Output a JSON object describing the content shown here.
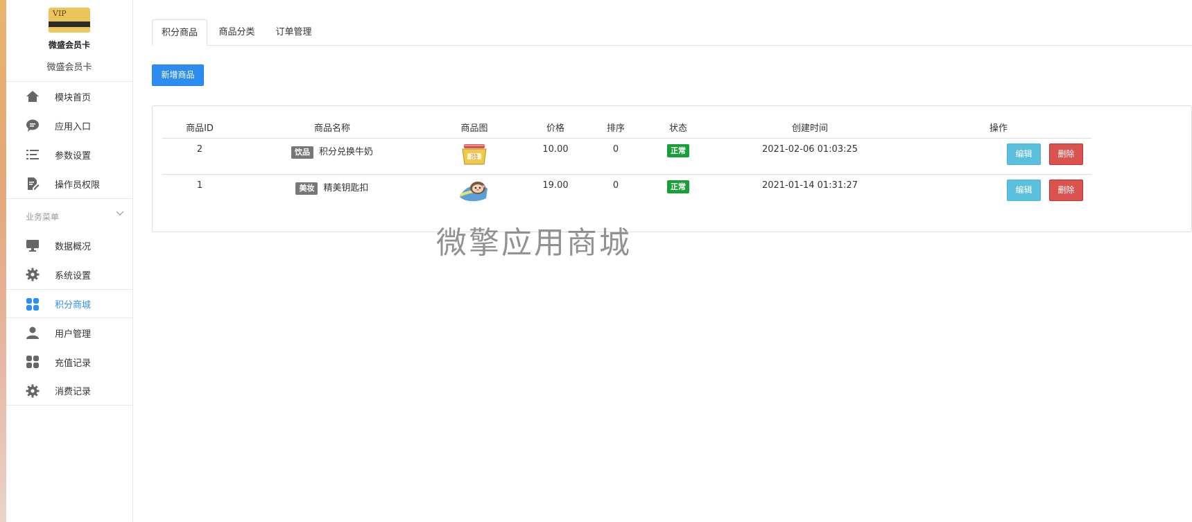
{
  "sidebar": {
    "brand_card_text": "VIP",
    "brand_name": "微盛会员卡",
    "brand_sub": "微盛会员卡",
    "top_items": [
      {
        "label": "模块首页",
        "icon": "home-icon"
      },
      {
        "label": "应用入口",
        "icon": "chat-bubble-icon"
      },
      {
        "label": "参数设置",
        "icon": "list-settings-icon"
      },
      {
        "label": "操作员权限",
        "icon": "edit-document-icon"
      }
    ],
    "group_title": "业务菜单",
    "group_items": [
      {
        "label": "数据概况",
        "icon": "monitor-icon"
      },
      {
        "label": "系统设置",
        "icon": "gear-icon"
      },
      {
        "label": "积分商城",
        "icon": "grid-apps-icon",
        "active": true
      },
      {
        "label": "用户管理",
        "icon": "user-icon"
      },
      {
        "label": "充值记录",
        "icon": "grid-apps-icon"
      },
      {
        "label": "消费记录",
        "icon": "gear-icon"
      }
    ]
  },
  "tabs": [
    {
      "label": "积分商品",
      "active": true
    },
    {
      "label": "商品分类"
    },
    {
      "label": "订单管理"
    }
  ],
  "toolbar": {
    "add_label": "新增商品"
  },
  "table": {
    "headers": [
      "商品ID",
      "商品名称",
      "商品图",
      "价格",
      "排序",
      "状态",
      "创建时间",
      "操作"
    ],
    "rows": [
      {
        "id": "2",
        "category": "饮品",
        "name": "积分兑换牛奶",
        "image": "skin-case-jar-image",
        "price": "10.00",
        "sort": "0",
        "status": "正常",
        "created": "2021-02-06 01:03:25",
        "edit": "编辑",
        "delete": "删除"
      },
      {
        "id": "1",
        "category": "美妆",
        "name": "精美钥匙扣",
        "image": "sloth-keychain-image",
        "price": "19.00",
        "sort": "0",
        "status": "正常",
        "created": "2021-01-14 01:31:27",
        "edit": "编辑",
        "delete": "删除"
      }
    ]
  },
  "watermark": "微擎应用商城",
  "colors": {
    "accent": "#2d8cf0",
    "active_nav": "#2b8ff7",
    "status_ok": "#1a9e3a",
    "edit_button": "#5bc0de",
    "delete_button": "#d9534f",
    "category_badge": "#777777"
  }
}
